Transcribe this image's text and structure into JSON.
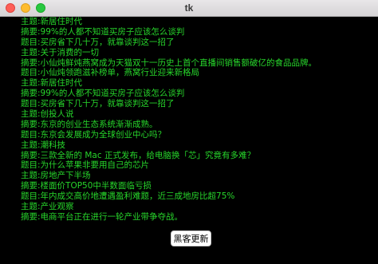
{
  "window": {
    "title": "tk"
  },
  "lines": [
    "主题:新居住时代",
    "摘要:99%的人都不知道买房子应该怎么谈判",
    "题目:买房省下几十万，就靠谈判这一招了",
    "主题:关于消费的一切",
    "摘要:小仙炖鲜炖燕窝成为天猫双十一历史上首个直播间销售额破亿的食品品牌。",
    "题目:小仙炖领跑滋补榜单，燕窝行业迎来新格局",
    "主题:新居住时代",
    "摘要:99%的人都不知道买房子应该怎么谈判",
    "题目:买房省下几十万，就靠谈判这一招了",
    "主题:创投人说",
    "摘要:东京的创业生态系统渐渐成熟。",
    "题目:东京会发展成为全球创业中心吗？",
    "主题:潮科技",
    "摘要:三款全新的 Mac 正式发布，给电脑换「芯」究竟有多难？",
    "题目:为什么苹果非要用自己的芯片",
    "主题:房地产下半场",
    "摘要:楼面价TOP50中半数面临亏损",
    "题目:年内成交高价地遭遇盈利难题，近三成地房比超75%",
    "主题:产业观察",
    "摘要:电商平台正在进行一轮产业带争夺战。"
  ],
  "refresh_button": {
    "label": "黑客更新"
  },
  "colors": {
    "text": "#27d62b",
    "background": "#000000"
  }
}
